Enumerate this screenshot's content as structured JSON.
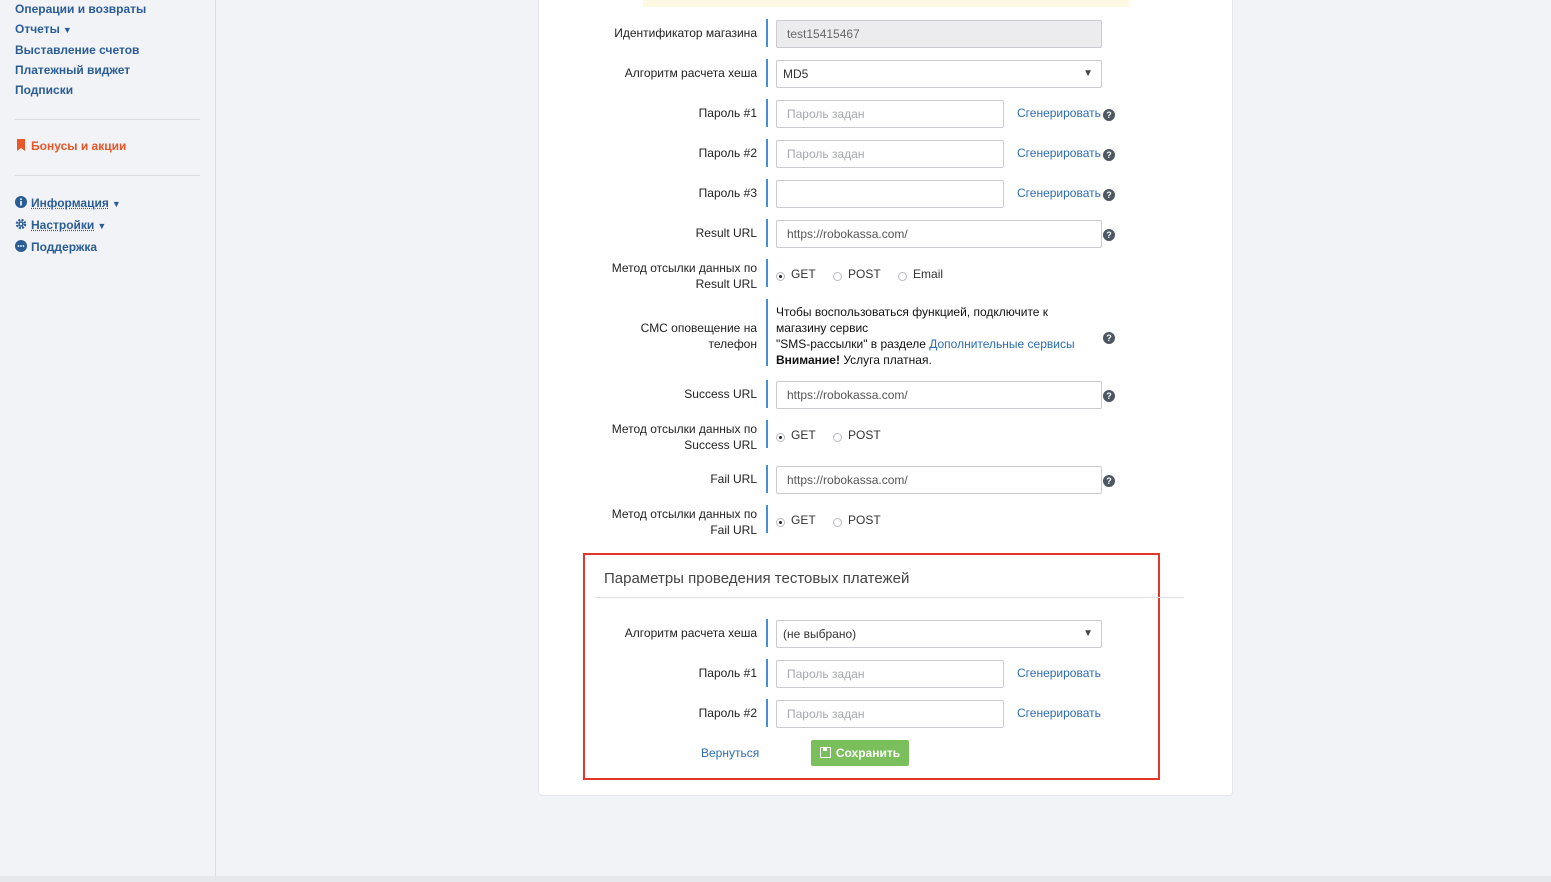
{
  "sidebar": {
    "items": [
      {
        "label": "Операции и возвраты"
      },
      {
        "label": "Отчеты",
        "caret": "▼"
      },
      {
        "label": "Выставление счетов"
      },
      {
        "label": "Платежный виджет"
      },
      {
        "label": "Подписки"
      }
    ],
    "bonus": "Бонусы и акции",
    "info": "Информация",
    "settings": "Настройки",
    "support": "Поддержка",
    "caret": "▼"
  },
  "form": {
    "shop_id_label": "Идентификатор магазина",
    "shop_id_value": "test15415467",
    "hash_label": "Алгоритм расчета хеша",
    "hash_value": "MD5",
    "pass1_label": "Пароль #1",
    "pass2_label": "Пароль #2",
    "pass3_label": "Пароль #3",
    "pass_placeholder": "Пароль задан",
    "generate": "Сгенерировать",
    "result_url_label": "Result URL",
    "result_url_value": "https://robokassa.com/",
    "result_method_label_1": "Метод отсылки данных по",
    "result_method_label_2": "Result URL",
    "method_get": "GET",
    "method_post": "POST",
    "method_email": "Email",
    "sms_label_1": "СМС оповещение на",
    "sms_label_2": "телефон",
    "sms_text_1": "Чтобы воспользоваться функцией, подключите к магазину сервис",
    "sms_text_2": "\"SMS-рассылки\" в разделе ",
    "sms_link": "Дополнительные сервисы",
    "sms_warning_bold": "Внимание!",
    "sms_warning_rest": " Услуга платная.",
    "success_url_label": "Success URL",
    "success_url_value": "https://robokassa.com/",
    "success_method_label_1": "Метод отсылки данных по",
    "success_method_label_2": "Success URL",
    "fail_url_label": "Fail URL",
    "fail_url_value": "https://robokassa.com/",
    "fail_method_label_1": "Метод отсылки данных по",
    "fail_method_label_2": "Fail URL"
  },
  "test": {
    "title": "Параметры проведения тестовых платежей",
    "hash_label": "Алгоритм расчета хеша",
    "hash_value": "(не выбрано)",
    "pass1_label": "Пароль #1",
    "pass2_label": "Пароль #2",
    "pass_placeholder": "Пароль задан",
    "generate": "Сгенерировать",
    "back": "Вернуться",
    "save": "Сохранить"
  },
  "icons": {
    "help": "?",
    "dropdown_arrow": "▼"
  },
  "colors": {
    "link": "#2b6cb0",
    "accent_bar": "#4a8fd4",
    "save_green": "#7bbf5c",
    "highlight_red": "#e2372a",
    "bonus_orange": "#e8562a"
  }
}
